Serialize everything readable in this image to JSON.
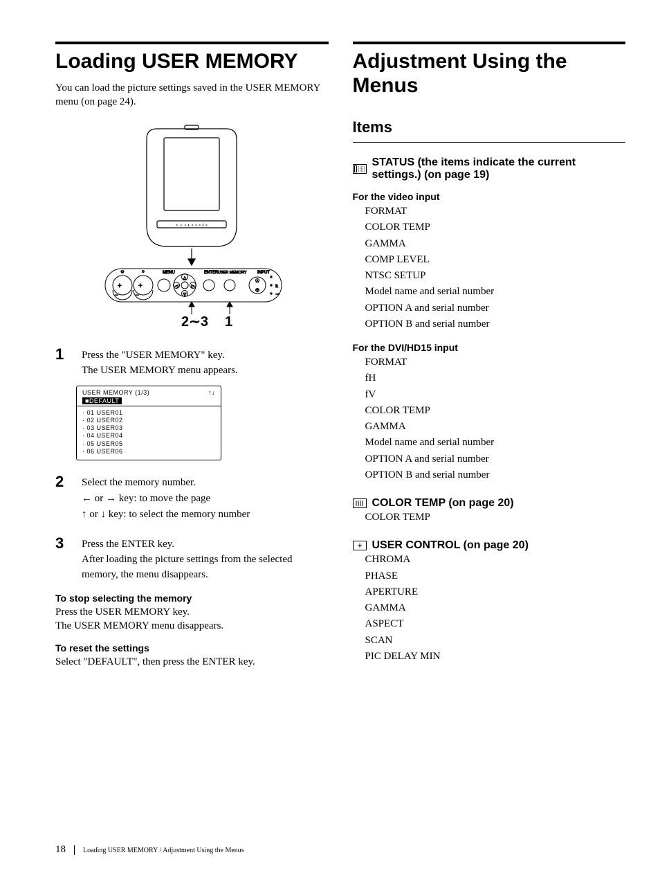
{
  "left": {
    "heading": "Loading USER MEMORY",
    "intro": "You can load the picture settings saved in the USER MEMORY menu (on page 24).",
    "panel_labels": {
      "menu": "MENU",
      "enter": "ENTER",
      "user_memory": "USER MEMORY",
      "input": "INPUT",
      "r": "R"
    },
    "callouts": {
      "left": "2∼3",
      "right": "1"
    },
    "step1": {
      "num": "1",
      "l1": "Press the \"USER MEMORY\" key.",
      "l2": "The USER MEMORY menu appears."
    },
    "menu_shot": {
      "title": "USER MEMORY (1/3)",
      "arrows": "↑↓",
      "default_marker": "■",
      "default": "DEFAULT",
      "entries": [
        "· 01 USER01",
        "· 02 USER02",
        "· 03 USER03",
        "· 04 USER04",
        "· 05 USER05",
        "· 06 USER06"
      ]
    },
    "step2": {
      "num": "2",
      "l1": "Select the memory number.",
      "l2_pre": "",
      "l2_arrows1": "←",
      "l2_or": " or ",
      "l2_arrows2": "→",
      "l2_post": " key: to move the page",
      "l3_arrows1": "↑",
      "l3_or": " or ",
      "l3_arrows2": "↓",
      "l3_post": " key: to select the memory number"
    },
    "step3": {
      "num": "3",
      "l1": "Press the ENTER key.",
      "l2": "After loading the picture settings from the selected memory, the menu disappears."
    },
    "stop_head": "To stop selecting the memory",
    "stop_l1": "Press the USER MEMORY key.",
    "stop_l2": "The USER MEMORY menu disappears.",
    "reset_head": "To reset the settings",
    "reset_l1": "Select \"DEFAULT\", then press the ENTER key."
  },
  "right": {
    "heading": "Adjustment Using the Menus",
    "items_head": "Items",
    "status_head": "STATUS (the items indicate the current settings.) (on page 19)",
    "video_head": "For the video input",
    "video_items": [
      "FORMAT",
      "COLOR TEMP",
      "GAMMA",
      "COMP LEVEL",
      "NTSC SETUP",
      "Model name and serial number",
      "OPTION A and serial number",
      "OPTION B and serial number"
    ],
    "dvi_head": "For the DVI/HD15 input",
    "dvi_items": [
      "FORMAT",
      "fH",
      "fV",
      "COLOR TEMP",
      "GAMMA",
      "Model name and serial number",
      "OPTION A and serial number",
      "OPTION B and serial number"
    ],
    "colortemp_head": "COLOR TEMP (on page 20)",
    "colortemp_items": [
      "COLOR TEMP"
    ],
    "userctrl_head": "USER CONTROL (on page 20)",
    "userctrl_items": [
      "CHROMA",
      "PHASE",
      "APERTURE",
      "GAMMA",
      "ASPECT",
      "SCAN",
      "PIC DELAY MIN"
    ]
  },
  "footer": {
    "page": "18",
    "text": "Loading USER MEMORY / Adjustment Using the Menus"
  }
}
